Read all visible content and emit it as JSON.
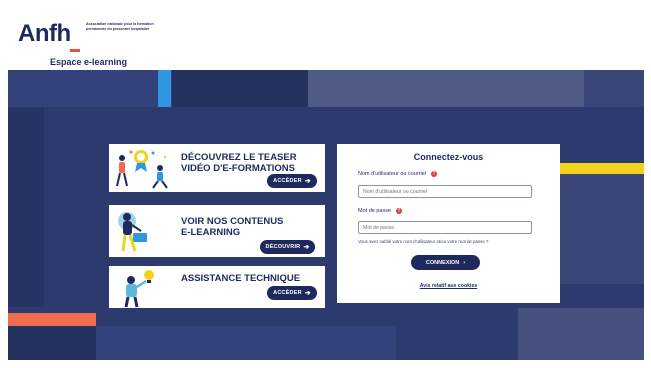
{
  "header": {
    "logo_text": "Anfh",
    "logo_tagline": "Association nationale pour la formation permanente du personnel hospitalier",
    "subtitle": "Espace e-learning"
  },
  "cards": [
    {
      "title": "DÉCOUVREZ LE TEASER VIDÉO D'E-FORMATIONS",
      "button": "ACCÉDER",
      "illustration": "people-and-award-illustration"
    },
    {
      "title": "VOIR NOS CONTENUS E-LEARNING",
      "button": "DÉCOUVRIR",
      "illustration": "person-with-laptop-illustration"
    },
    {
      "title": "ASSISTANCE TECHNIQUE",
      "button": "ACCÉDER",
      "illustration": "person-with-lightbulb-illustration"
    }
  ],
  "login": {
    "title": "Connectez-vous",
    "username_label": "Nom d'utilisateur ou courriel",
    "username_placeholder": "Nom d'utilisateur ou courriel",
    "password_label": "Mot de passe",
    "password_placeholder": "Mot de passe",
    "forgot_text": "Vous avez oublié votre nom d'utilisateur et/ou votre mot de passe ?",
    "submit_label": "CONNEXION",
    "cookies_link": "Avis relatif aux cookies"
  },
  "colors": {
    "navy": "#2d3a6e",
    "dark_navy": "#1e2a5e",
    "accent_blue": "#2f97e0",
    "accent_yellow": "#f2d31b",
    "accent_orange": "#ef6d4f",
    "required_red": "#e23b3b"
  },
  "icons": {
    "arrow": "arrow-right-icon",
    "chevron": "chevron-right-icon",
    "required": "required-icon"
  }
}
